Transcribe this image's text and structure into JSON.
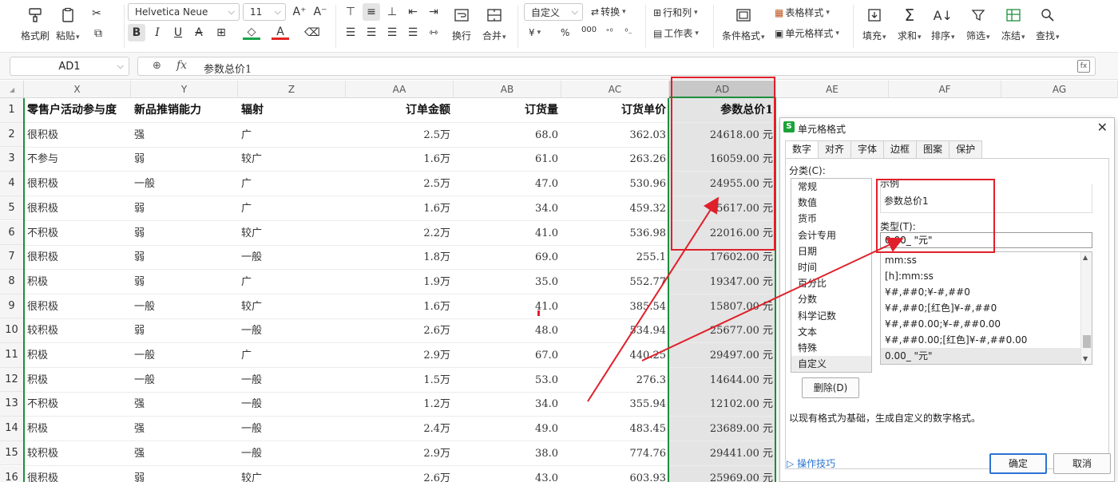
{
  "toolbar": {
    "format_painter": "格式刷",
    "paste": "粘贴",
    "font_name": "Helvetica Neue",
    "font_size": "11",
    "wrap": "换行",
    "merge": "合并",
    "number_format": "自定义",
    "convert": "转换",
    "rows_cols": "行和列",
    "worksheet": "工作表",
    "table_style": "表格样式",
    "cond_format": "条件格式",
    "cell_style": "单元格样式",
    "fill": "填充",
    "sum": "求和",
    "sort": "排序",
    "filter": "筛选",
    "freeze": "冻结",
    "find": "查找",
    "currency_symbol": "¥",
    "percent_symbol": "%",
    "thousands_symbol": "000"
  },
  "formula_bar": {
    "name_box": "AD1",
    "fx_label": "fx",
    "content": "参数总价1"
  },
  "columns": [
    "X",
    "Y",
    "Z",
    "AA",
    "AB",
    "AC",
    "AD",
    "AE",
    "AF",
    "AG"
  ],
  "rows": [
    "1",
    "2",
    "3",
    "4",
    "5",
    "6",
    "7",
    "8",
    "9",
    "10",
    "11",
    "12",
    "13",
    "14",
    "15",
    "16"
  ],
  "headers": [
    "零售户活动参与度",
    "新品推销能力",
    "辐射",
    "订单金额",
    "订货量",
    "订货单价",
    "参数总价1"
  ],
  "data": [
    [
      "很积极",
      "强",
      "广",
      "2.5万",
      "68.0",
      "362.03",
      "24618.00 元"
    ],
    [
      "不参与",
      "弱",
      "较广",
      "1.6万",
      "61.0",
      "263.26",
      "16059.00 元"
    ],
    [
      "很积极",
      "一般",
      "广",
      "2.5万",
      "47.0",
      "530.96",
      "24955.00 元"
    ],
    [
      "很积极",
      "弱",
      "广",
      "1.6万",
      "34.0",
      "459.32",
      "15617.00 元"
    ],
    [
      "不积极",
      "弱",
      "较广",
      "2.2万",
      "41.0",
      "536.98",
      "22016.00 元"
    ],
    [
      "很积极",
      "弱",
      "一般",
      "1.8万",
      "69.0",
      "255.1",
      "17602.00 元"
    ],
    [
      "积极",
      "弱",
      "广",
      "1.9万",
      "35.0",
      "552.77",
      "19347.00 元"
    ],
    [
      "很积极",
      "一般",
      "较广",
      "1.6万",
      "41.0",
      "385.54",
      "15807.00 元"
    ],
    [
      "较积极",
      "弱",
      "一般",
      "2.6万",
      "48.0",
      "534.94",
      "25677.00 元"
    ],
    [
      "积极",
      "一般",
      "广",
      "2.9万",
      "67.0",
      "440.25",
      "29497.00 元"
    ],
    [
      "积极",
      "一般",
      "一般",
      "1.5万",
      "53.0",
      "276.3",
      "14644.00 元"
    ],
    [
      "不积极",
      "强",
      "一般",
      "1.2万",
      "34.0",
      "355.94",
      "12102.00 元"
    ],
    [
      "积极",
      "强",
      "一般",
      "2.4万",
      "49.0",
      "483.45",
      "23689.00 元"
    ],
    [
      "较积极",
      "强",
      "一般",
      "2.9万",
      "38.0",
      "774.76",
      "29441.00 元"
    ],
    [
      "很积极",
      "弱",
      "较广",
      "2.6万",
      "43.0",
      "603.93",
      "25969.00 元"
    ]
  ],
  "dialog": {
    "title": "单元格格式",
    "close": "✕",
    "tabs": [
      "数字",
      "对齐",
      "字体",
      "边框",
      "图案",
      "保护"
    ],
    "category_label": "分类(C):",
    "categories": [
      "常规",
      "数值",
      "货币",
      "会计专用",
      "日期",
      "时间",
      "百分比",
      "分数",
      "科学记数",
      "文本",
      "特殊",
      "自定义"
    ],
    "sample_label": "示例",
    "sample_value": "参数总价1",
    "type_label": "类型(T):",
    "type_value": "0.00_ \"元\"",
    "formats": [
      "mm:ss",
      "[h]:mm:ss",
      "¥#,##0;¥-#,##0",
      "¥#,##0;[红色]¥-#,##0",
      "¥#,##0.00;¥-#,##0.00",
      "¥#,##0.00;[红色]¥-#,##0.00",
      "0.00_ \"元\""
    ],
    "delete": "删除(D)",
    "hint": "以现有格式为基础，生成自定义的数字格式。",
    "tips": "操作技巧",
    "ok": "确定",
    "cancel": "取消"
  },
  "colors": {
    "accent": "#1e8e3e",
    "annotation": "#e0202a",
    "wps_green": "#1aa33a"
  }
}
